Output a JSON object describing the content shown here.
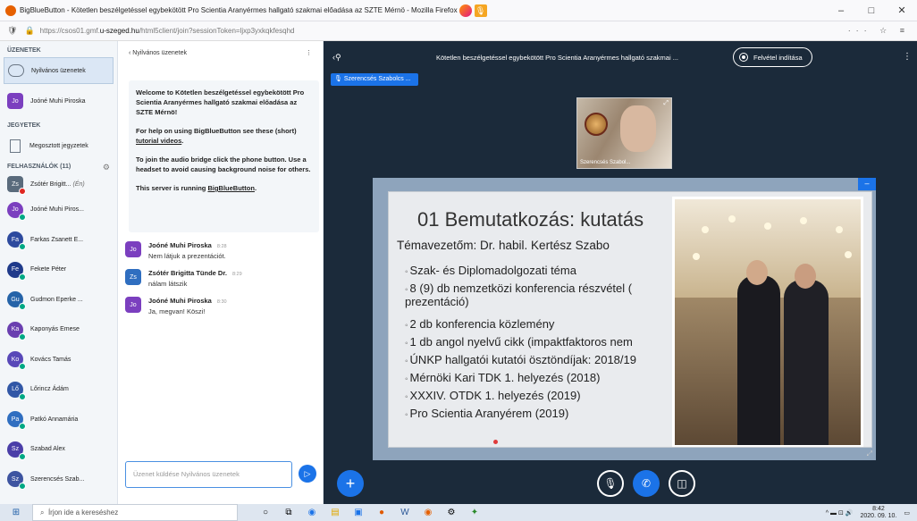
{
  "browser": {
    "window_title": "BigBlueButton - Kötetlen beszélgetéssel egybekötött Pro Scientia Aranyérmes hallgató szakmai előadása az SZTE Mérnö - Mozilla Firefox",
    "url_prefix": "https://csos01.gmf.",
    "url_domain": "u-szeged.hu",
    "url_path": "/html5client/join?sessionToken=ljxp3yxkqkfesqhd"
  },
  "sidebar": {
    "messages_title": "ÜZENETEK",
    "public_chat": "Nyilvános üzenetek",
    "private_chat": {
      "initials": "Jo",
      "name": "Joóné Muhi Piroska"
    },
    "notes_title": "JEGYETEK",
    "shared_notes": "Megosztott jegyzetek",
    "users_title": "FELHASZNÁLÓK (11)",
    "users": [
      {
        "initials": "Zs",
        "name": "Zsótér Brigitt...",
        "you": "(Én)",
        "color": "#5a6b7c",
        "status": "red"
      },
      {
        "initials": "Jo",
        "name": "Joóné Muhi Piros...",
        "color": "#7b3fbf",
        "status": "green"
      },
      {
        "initials": "Fa",
        "name": "Farkas Zsanett E...",
        "color": "#2d4a9e",
        "status": "green"
      },
      {
        "initials": "Fe",
        "name": "Fekete Péter",
        "color": "#1f3a8a",
        "status": "green"
      },
      {
        "initials": "Gu",
        "name": "Gudmon Eperke ...",
        "color": "#2563a8",
        "status": "green"
      },
      {
        "initials": "Ka",
        "name": "Kaponyás Emese",
        "color": "#6a3fb0",
        "status": "green"
      },
      {
        "initials": "Ko",
        "name": "Kovács Tamás",
        "color": "#5848b8",
        "status": "green"
      },
      {
        "initials": "Lő",
        "name": "Lőrincz Ádám",
        "color": "#3157a6",
        "status": "green"
      },
      {
        "initials": "Pa",
        "name": "Patkó Annamária",
        "color": "#2f6ec0",
        "status": "green"
      },
      {
        "initials": "Sz",
        "name": "Szabad Alex",
        "color": "#4a3ea8",
        "status": "green"
      },
      {
        "initials": "Sz",
        "name": "Szerencsés Szab...",
        "color": "#3d54a0",
        "status": "green"
      }
    ]
  },
  "chat": {
    "title": "Nyilvános üzenetek",
    "welcome_1a": "Welcome to ",
    "welcome_1b": "Kötetlen beszélgetéssel egybekötött Pro Scientia Aranyérmes hallgató szakmai előadása az SZTE Mérnö",
    "welcome_1c": "!",
    "welcome_2a": "For help on using BigBlueButton see these (short) ",
    "welcome_2b": "tutorial videos",
    "welcome_2c": ".",
    "welcome_3": "To join the audio bridge click the phone button. Use a headset to avoid causing background noise for others.",
    "welcome_4a": "This server is running ",
    "welcome_4b": "BigBlueButton",
    "welcome_4c": ".",
    "messages": [
      {
        "initials": "Jo",
        "name": "Joóné Muhi Piroska",
        "time": "8:28",
        "text": "Nem látjuk a prezentációt.",
        "color": "#7b3fbf"
      },
      {
        "initials": "Zs",
        "name": "Zsótér Brigitta Tünde Dr.",
        "time": "8:29",
        "text": "nálam látszik",
        "color": "#2f6ec0"
      },
      {
        "initials": "Jo",
        "name": "Joóné Muhi Piroska",
        "time": "8:30",
        "text": "Ja, megvan! Köszi!",
        "color": "#7b3fbf"
      }
    ],
    "input_placeholder": "Üzenet küldése Nyilvános üzenetek"
  },
  "main": {
    "meeting_title": "Kötetlen beszélgetéssel egybekötött Pro Scientia Aranyérmes hallgató szakmai ...",
    "record_label": "Felvétel indítása",
    "talker": "Szerencsés Szabolcs ...",
    "webcam_name": "Szerencsés Szabol..."
  },
  "slide": {
    "title": "01 Bemutatkozás: kutatás",
    "supervisor": "Témavezetőm: Dr. habil. Kertész Szabo",
    "bullets": [
      "Szak- és Diplomadolgozati téma",
      "8 (9) db nemzetközi konferencia részvétel (",
      "prezentáció)",
      "2 db konferencia közlemény",
      "1 db angol nyelvű cikk (impaktfaktoros nem",
      "ÚNKP hallgatói kutatói ösztöndíjak: 2018/19",
      "Mérnöki Kari TDK 1. helyezés (2018)",
      "XXXIV. OTDK 1. helyezés (2019)",
      "Pro Scientia Aranyérem (2019)"
    ]
  },
  "taskbar": {
    "search_placeholder": "Írjon ide a kereséshez",
    "time": "8:42",
    "date": "2020. 09. 10."
  }
}
